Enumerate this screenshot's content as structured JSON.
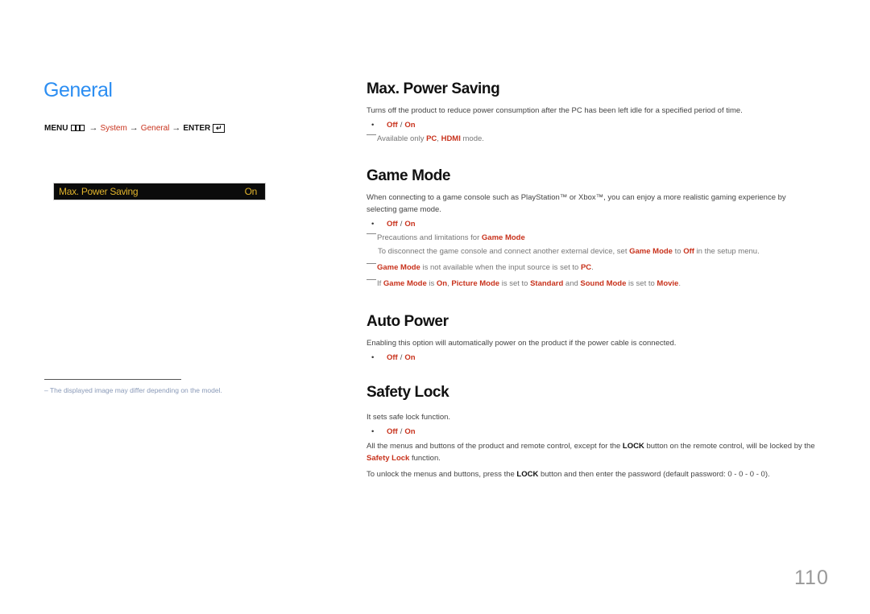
{
  "left": {
    "title": "General",
    "menu_path": {
      "menu": "MENU",
      "menu_icon": "menu-grid-icon",
      "arrow": "→",
      "items": [
        "System",
        "General"
      ],
      "enter": "ENTER",
      "enter_icon": "enter-return-icon",
      "enter_glyph": "↵"
    },
    "osd": {
      "label": "Max. Power Saving",
      "value": "On"
    },
    "footnote": "–  The displayed image may differ depending on the model."
  },
  "sections": {
    "max_power_saving": {
      "title": "Max. Power Saving",
      "description": "Turns off the product to reduce power consumption after the PC has been left idle for a specified period of time.",
      "options": {
        "off": "Off",
        "sep": "/",
        "on": "On"
      },
      "note": {
        "pre": "Available only ",
        "hl1": "PC",
        "mid": ", ",
        "hl2": "HDMI",
        "post": " mode."
      }
    },
    "game_mode": {
      "title": "Game Mode",
      "description": "When connecting to a game console such as PlayStation™ or Xbox™, you can enjoy a more realistic gaming experience by selecting game mode.",
      "options": {
        "off": "Off",
        "sep": "/",
        "on": "On"
      },
      "note1": {
        "pre": "Precautions and limitations for ",
        "hl": "Game Mode"
      },
      "note1_detail": {
        "pre": "To disconnect the game console and connect another external device, set ",
        "hl1": "Game Mode",
        "mid": " to ",
        "hl2": "Off",
        "post": " in the setup menu."
      },
      "note2": {
        "hl1": "Game Mode",
        "mid": " is not available when the input source is set to ",
        "hl2": "PC",
        "post": "."
      },
      "note3": {
        "pre": "If ",
        "hl1": "Game Mode",
        "t1": " is ",
        "hl2": "On",
        "t2": ", ",
        "hl3": "Picture Mode",
        "t3": " is set to ",
        "hl4": "Standard",
        "t4": " and ",
        "hl5": "Sound Mode",
        "t5": " is set to ",
        "hl6": "Movie",
        "post": "."
      }
    },
    "auto_power": {
      "title": "Auto Power",
      "description": "Enabling this option will automatically power on the product if the power cable is connected.",
      "options": {
        "off": "Off",
        "sep": "/",
        "on": "On"
      }
    },
    "safety_lock": {
      "title": "Safety Lock",
      "description": "It sets safe lock function.",
      "options": {
        "off": "Off",
        "sep": "/",
        "on": "On"
      },
      "para1": {
        "pre": "All the menus and buttons of the product and remote control, except for the ",
        "b": "LOCK",
        "mid": " button on the remote control, will be locked by the ",
        "hl": "Safety Lock",
        "post": " function."
      },
      "para2": {
        "pre": "To unlock the menus and buttons, press the ",
        "b": "LOCK",
        "post": " button and then enter the password (default password: 0 - 0 - 0 - 0)."
      }
    }
  },
  "page_number": "110",
  "colors": {
    "title_blue": "#2c8ef2",
    "highlight_red": "#c8321c",
    "osd_text": "#e0b32c",
    "osd_bg": "#0b0b0b"
  }
}
